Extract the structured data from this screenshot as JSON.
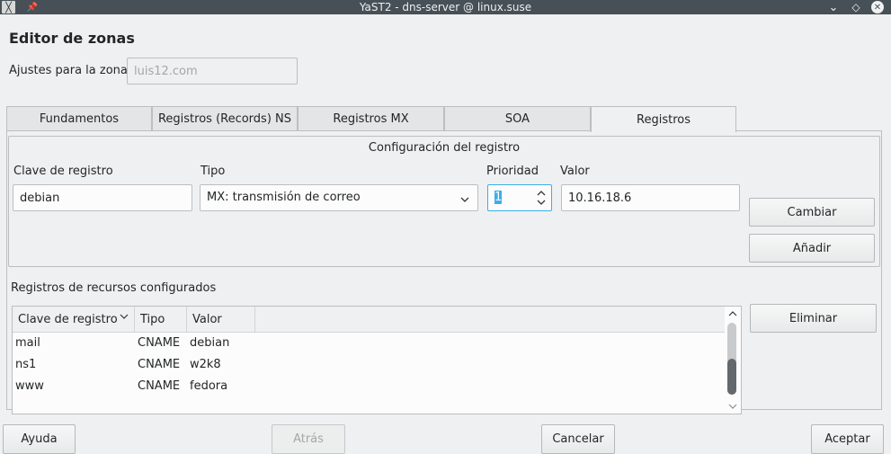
{
  "window": {
    "title": "YaST2 - dns-server @ linux.suse",
    "app_icon_glyph": "╳",
    "pin_glyph": "📌",
    "buttons": {
      "minimize": "⌄",
      "maximize": "◇",
      "close": "✕"
    }
  },
  "heading": "Editor de zonas",
  "zone": {
    "label": "Ajustes para la zona",
    "value": "luis12.com"
  },
  "tabs": [
    {
      "label": "Fundamentos"
    },
    {
      "label": "Registros (Records) NS"
    },
    {
      "label": "Registros MX"
    },
    {
      "label": "SOA"
    },
    {
      "label": "Registros",
      "active": true
    }
  ],
  "record_config": {
    "title": "Configuración del registro",
    "key_label": "Clave de registro",
    "key_value": "debian",
    "type_label": "Tipo",
    "type_value": "MX: transmisión de correo",
    "priority_label": "Prioridad",
    "priority_value": "1",
    "value_label": "Valor",
    "value_value": "10.16.18.6",
    "change_button": "Cambiar",
    "add_button": "Añadir"
  },
  "resources": {
    "title": "Registros de recursos configurados",
    "columns": [
      "Clave de registro",
      "Tipo",
      "Valor"
    ],
    "sort_glyph": "⌄",
    "rows": [
      {
        "key": "mail",
        "type": "CNAME",
        "value": "debian"
      },
      {
        "key": "ns1",
        "type": "CNAME",
        "value": "w2k8"
      },
      {
        "key": "www",
        "type": "CNAME",
        "value": "fedora"
      }
    ],
    "delete_button": "Eliminar"
  },
  "footer": {
    "help": "Ayuda",
    "back": "Atrás",
    "cancel": "Cancelar",
    "accept": "Aceptar"
  },
  "colors": {
    "titlebar": "#475057",
    "background": "#eff0f1",
    "focus": "#3daee9"
  }
}
